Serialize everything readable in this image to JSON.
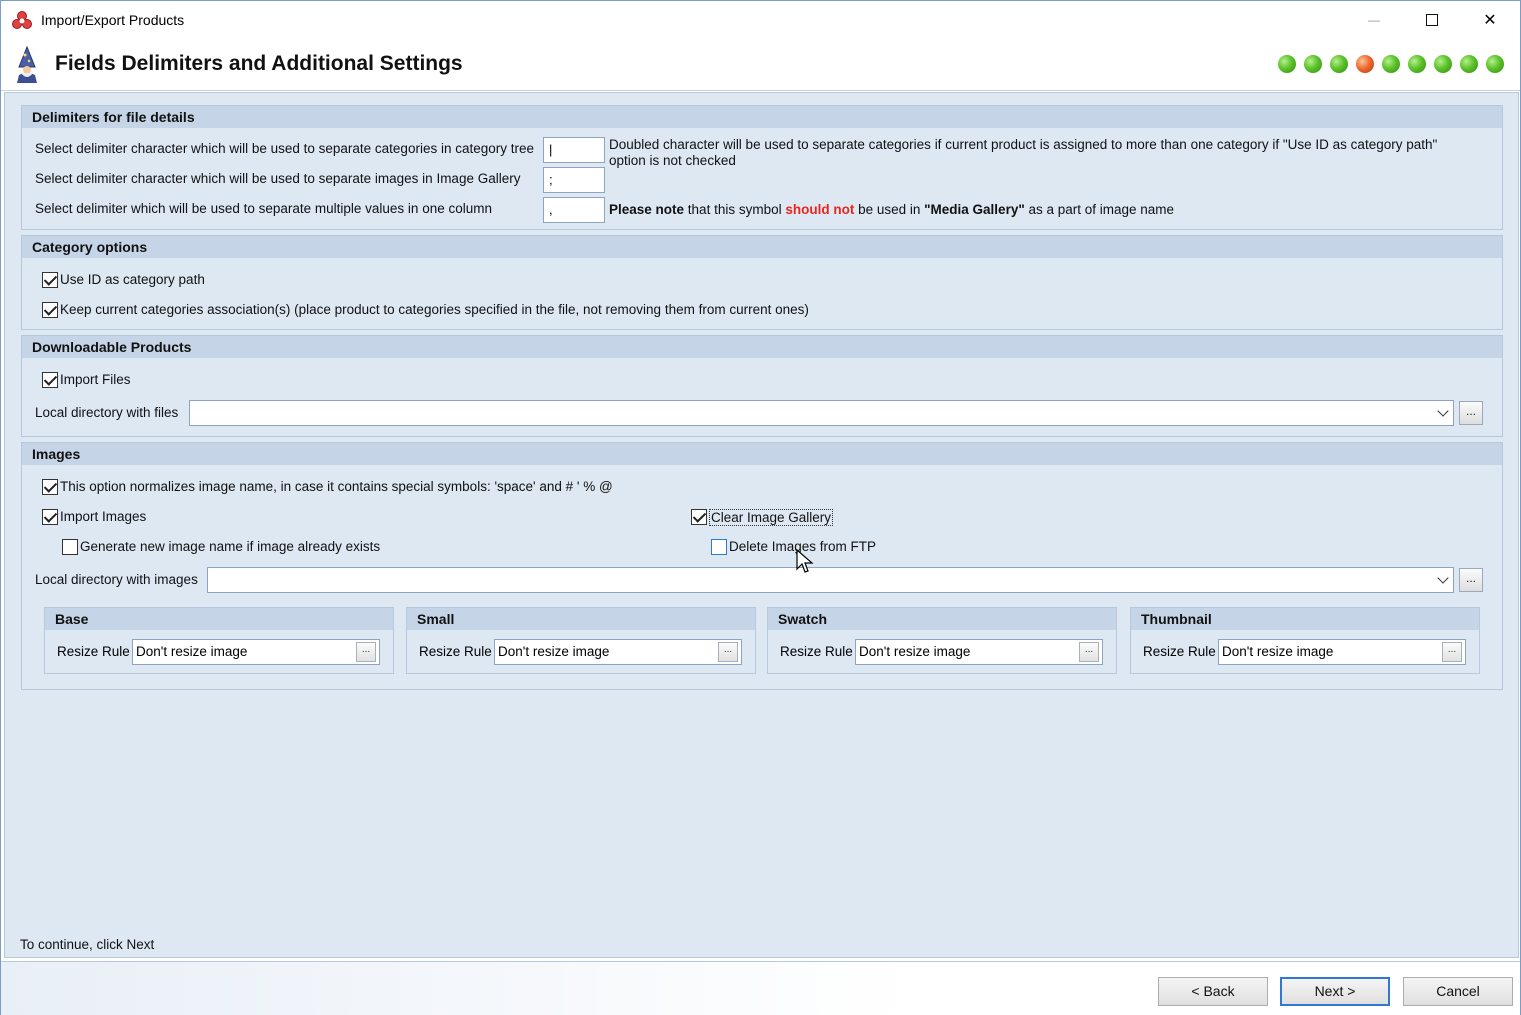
{
  "window": {
    "title": "Import/Export Products",
    "minimize_glyph": "—",
    "maximize_glyph": "☐",
    "close_glyph": "✕"
  },
  "header": {
    "title": "Fields Delimiters and Additional Settings",
    "steps_total": 9,
    "active_step": 4,
    "step_colors": {
      "done": "#5cc22a",
      "active": "#f06a2e"
    }
  },
  "delimiters": {
    "section_title": "Delimiters for file details",
    "category_label": "Select delimiter character which will be used to separate categories in category tree",
    "category_value": "|",
    "category_note": "Doubled character will be used to separate categories if current product is assigned to more than one category if \"Use ID as category path\" option is not checked",
    "images_label": "Select delimiter character which will be used to separate images in Image Gallery",
    "images_value": ";",
    "multi_label": "Select delimiter which will be used to separate multiple values in one column",
    "multi_value": ",",
    "note": {
      "please_note": "Please note",
      "text1": " that this symbol ",
      "should_not": "should not",
      "text2": " be used in ",
      "media_gallery": "\"Media Gallery\"",
      "text3": " as a part of image name"
    }
  },
  "category_options": {
    "section_title": "Category options",
    "use_id_label": "Use ID as category path",
    "use_id_checked": true,
    "keep_current_label": "Keep current categories association(s) (place product to categories specified in the file, not removing them from current ones)",
    "keep_current_checked": true
  },
  "downloadable": {
    "section_title": "Downloadable Products",
    "import_files_label": "Import Files",
    "import_files_checked": true,
    "local_dir_label": "Local directory with files",
    "local_dir_value": "",
    "browse_label": "..."
  },
  "images": {
    "section_title": "Images",
    "normalize_label": "This option normalizes image name, in case it contains special symbols: 'space' and # ' % @",
    "normalize_checked": true,
    "import_images_label": "Import Images",
    "import_images_checked": true,
    "generate_new_label": "Generate new image name if image already exists",
    "generate_new_checked": false,
    "clear_gallery_label": "Clear Image Gallery",
    "clear_gallery_checked": true,
    "delete_ftp_label": "Delete Images from FTP",
    "delete_ftp_checked": false,
    "local_dir_label": "Local directory with images",
    "local_dir_value": "",
    "browse_label": "...",
    "resize_rule_label": "Resize Rule",
    "resize_btn_label": "...",
    "sizes": [
      {
        "name": "Base",
        "value": "Don't resize image"
      },
      {
        "name": "Small",
        "value": "Don't resize image"
      },
      {
        "name": "Swatch",
        "value": "Don't resize image"
      },
      {
        "name": "Thumbnail",
        "value": "Don't resize image"
      }
    ]
  },
  "footer": {
    "hint": "To continue, click Next",
    "back_label": "< Back",
    "next_label": "Next >",
    "cancel_label": "Cancel"
  }
}
